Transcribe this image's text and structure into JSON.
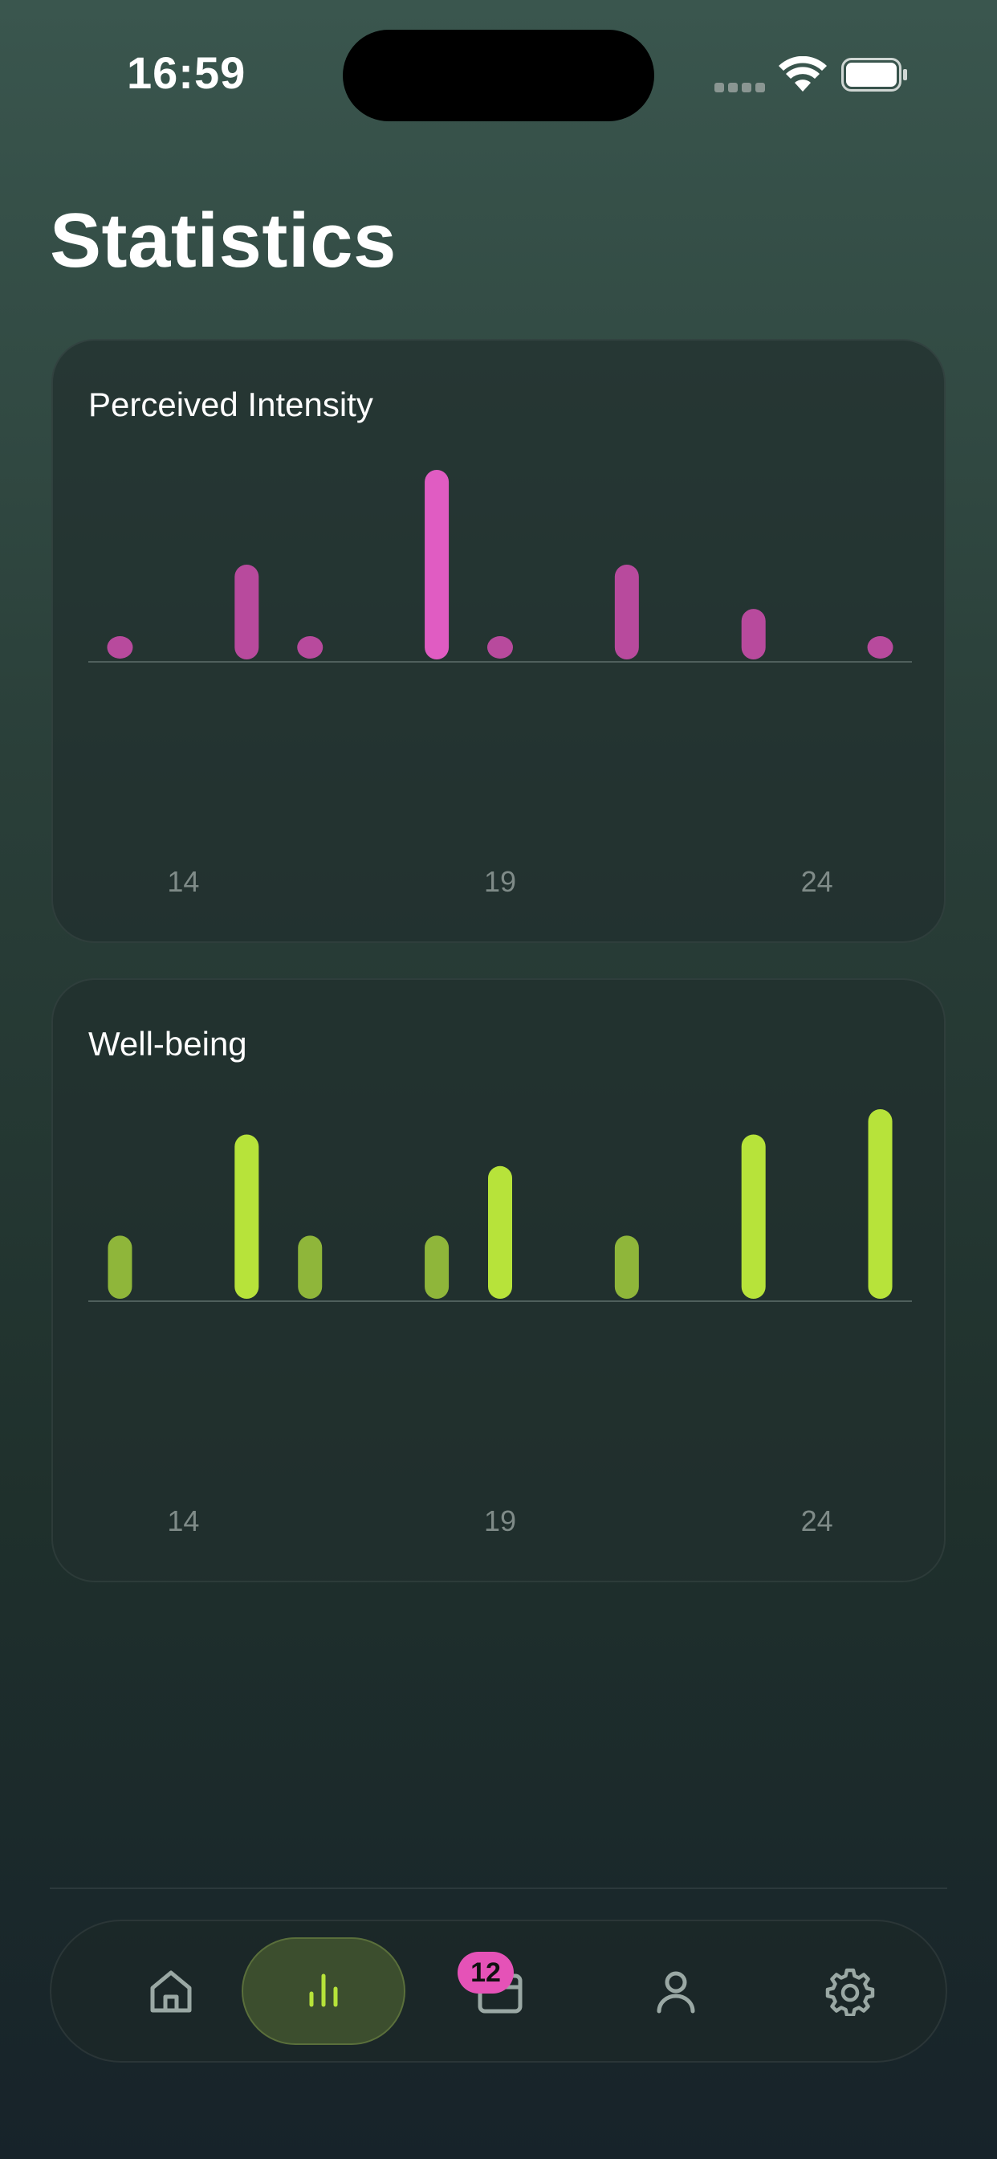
{
  "status_bar": {
    "time": "16:59"
  },
  "page": {
    "title": "Statistics"
  },
  "cards": [
    {
      "title": "Perceived Intensity",
      "accent_color": "#e05cc2",
      "dim_color": "#b84a9d"
    },
    {
      "title": "Well-being",
      "accent_color": "#b7e33a",
      "dim_color": "#8fb63a"
    }
  ],
  "chart_data": [
    {
      "type": "bar",
      "x": [
        13,
        15,
        16,
        18,
        19,
        21,
        23,
        25
      ],
      "values": [
        0,
        1.5,
        0,
        3,
        0,
        1.5,
        0.8,
        0
      ],
      "xticks": [
        "14",
        "19",
        "24"
      ],
      "xlim": [
        12.5,
        25.5
      ]
    },
    {
      "type": "bar",
      "x": [
        13,
        15,
        16,
        18,
        19,
        21,
        23,
        25
      ],
      "values": [
        1,
        2.6,
        1,
        1,
        2.1,
        1,
        2.6,
        3
      ],
      "xticks": [
        "14",
        "19",
        "24"
      ],
      "xlim": [
        12.5,
        25.5
      ]
    }
  ],
  "tab_bar": {
    "active": "stats",
    "calendar_badge": "12",
    "tabs": [
      {
        "id": "home",
        "icon": "home-icon"
      },
      {
        "id": "stats",
        "icon": "bar-chart-icon"
      },
      {
        "id": "calendar",
        "icon": "calendar-icon"
      },
      {
        "id": "profile",
        "icon": "person-icon"
      },
      {
        "id": "settings",
        "icon": "gear-icon"
      }
    ],
    "active_color": "#b7e33a",
    "inactive_color": "#9aa8a4"
  }
}
